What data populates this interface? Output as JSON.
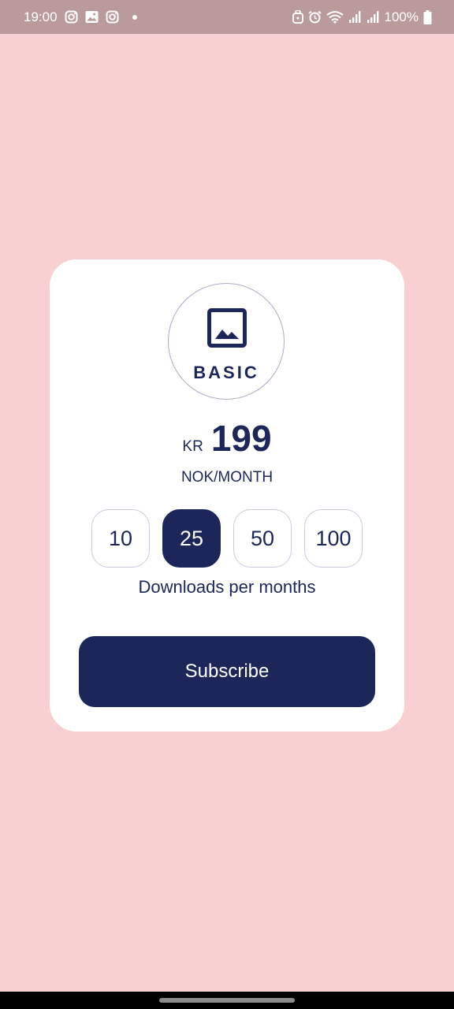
{
  "status_bar": {
    "time": "19:00",
    "battery": "100%",
    "left_icons": [
      "instagram-icon",
      "gallery-icon",
      "instagram-icon",
      "notification-dot"
    ],
    "right_icons": [
      "vpn-lock-icon",
      "alarm-icon",
      "wifi-icon",
      "signal-icon",
      "signal-icon",
      "battery-icon"
    ]
  },
  "plan": {
    "icon": "image-icon",
    "name": "BASIC",
    "currency": "KR",
    "price": "199",
    "period": "NOK/MONTH"
  },
  "downloads": {
    "options": [
      "10",
      "25",
      "50",
      "100"
    ],
    "selected": "25",
    "caption": "Downloads per months"
  },
  "subscribe_label": "Subscribe",
  "colors": {
    "background": "#f9d0d1",
    "status_bar": "#bb9a9c",
    "card": "#ffffff",
    "accent": "#1d2659"
  }
}
